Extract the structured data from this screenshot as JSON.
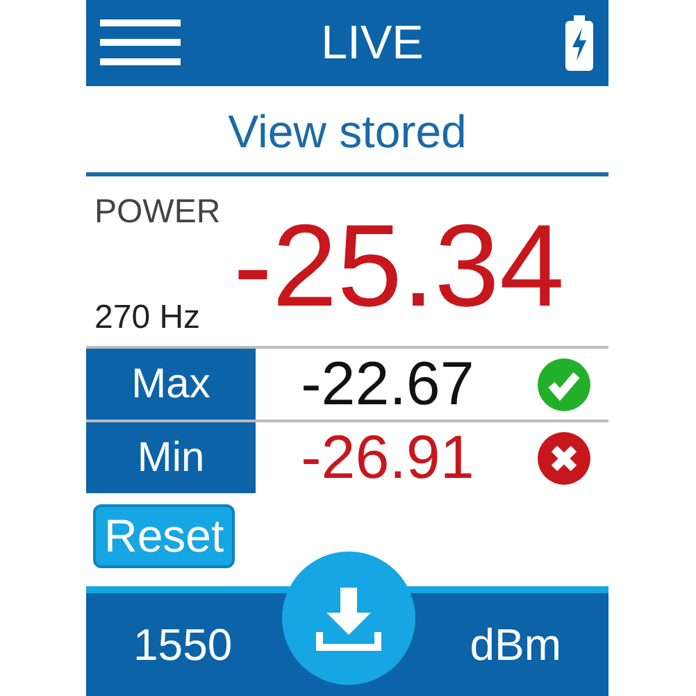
{
  "header": {
    "title": "LIVE"
  },
  "view_link": "View stored",
  "measurement": {
    "label": "POWER",
    "frequency": "270 Hz",
    "value": "-25.34"
  },
  "limits": [
    {
      "label": "Max",
      "value": "-22.67",
      "passed": true
    },
    {
      "label": "Min",
      "value": "-26.91",
      "passed": false
    }
  ],
  "reset_button": "Reset",
  "footer": {
    "wavelength": "1550",
    "unit": "dBm"
  }
}
